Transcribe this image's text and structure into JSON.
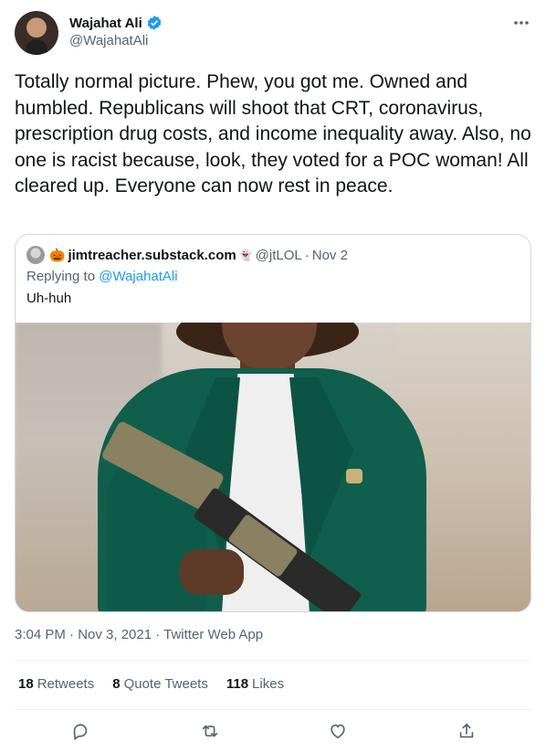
{
  "author": {
    "display_name": "Wajahat Ali",
    "handle": "@WajahatAli",
    "verified_icon": "verified-badge-icon",
    "more_icon": "more-horizontal-icon"
  },
  "tweet": {
    "text": "Totally normal picture. Phew, you got me. Owned and humbled. Republicans will shoot that CRT, coronavirus, prescription drug costs, and income inequality away. Also, no one is racist because, look, they voted for a POC woman! All cleared up. Everyone can now rest in peace."
  },
  "quote": {
    "name_prefix_emoji": "🎃",
    "name": "jimtreacher.substack.com",
    "name_suffix_emoji": "👻",
    "handle": "@jtLOL",
    "separator": "·",
    "date": "Nov 2",
    "replying_prefix": "Replying to ",
    "replying_handle": "@WajahatAli",
    "text": "Uh-huh"
  },
  "meta": {
    "timestamp": "3:04 PM · Nov 3, 2021 · Twitter Web App"
  },
  "stats": {
    "retweets_count": "18",
    "retweets_label": "Retweets",
    "quotes_count": "8",
    "quotes_label": "Quote Tweets",
    "likes_count": "118",
    "likes_label": "Likes"
  },
  "actions": [
    "reply-icon",
    "retweet-icon",
    "like-icon",
    "share-icon"
  ],
  "colors": {
    "accent": "#1d9bf0",
    "text": "#0f1419",
    "secondary": "#536471",
    "border": "#cfd9de"
  }
}
